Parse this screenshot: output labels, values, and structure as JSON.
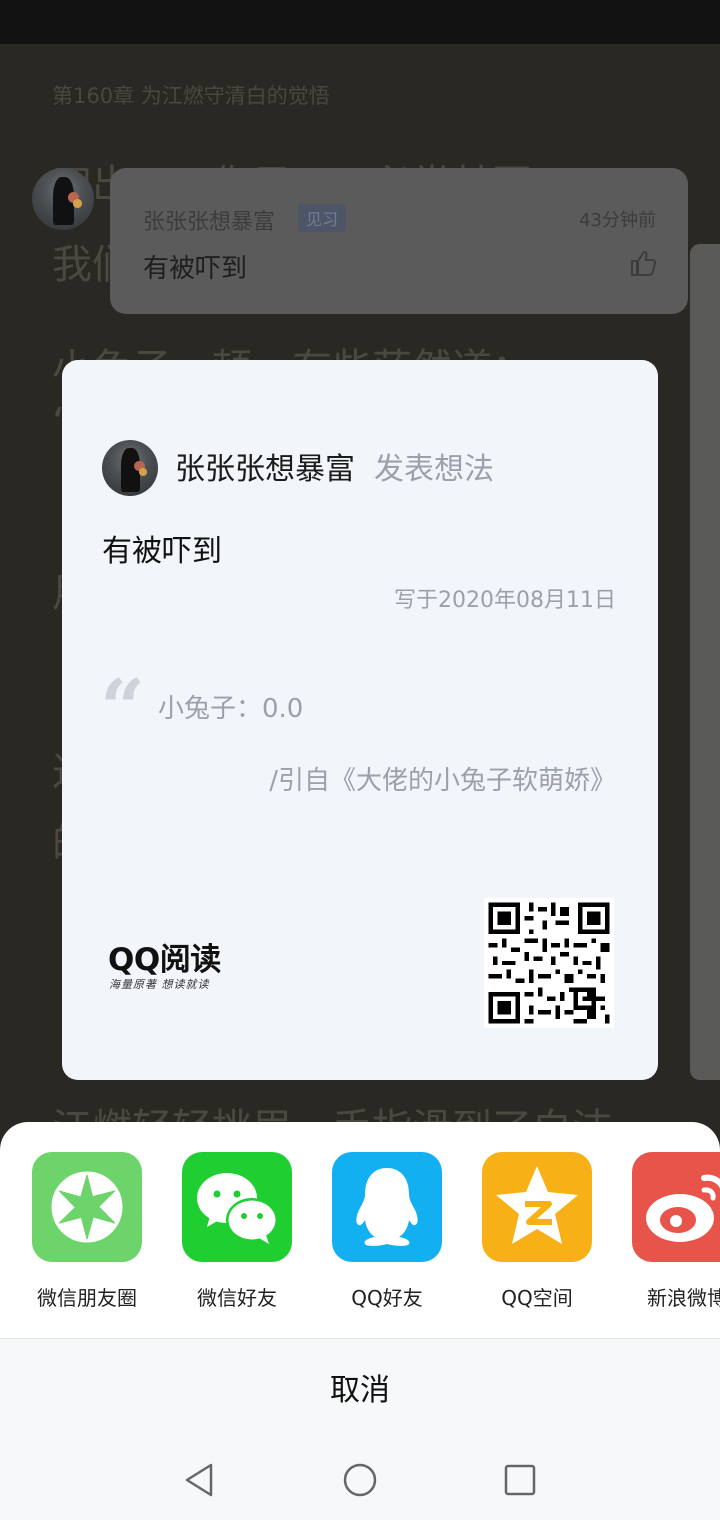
{
  "background": {
    "chapter_title": "第160章 为江燃守清白的觉悟",
    "lines": [
      "四出一、你子一、必党甘写",
      "我们",
      "小兔子一顿，有些茫然道：",
      "“",
      "",
      "用",
      "",
      "过",
      "的",
      "江燃轻轻挑眉，手指滑到了白洁"
    ],
    "comment": {
      "username": "张张张想暴富",
      "badge": "见习",
      "time": "43分钟前",
      "text": "有被吓到",
      "like_icon": "thumbs-up-icon"
    }
  },
  "card": {
    "author": "张张张想暴富",
    "action": "发表想法",
    "content": "有被吓到",
    "date": "写于2020年08月11日",
    "quote_mark": "“",
    "quote": "小兔子：0.0",
    "source": "/引自《大佬的小兔子软萌娇》",
    "brand": "QQ阅读",
    "slogan": "海量原著 想读就读"
  },
  "share": {
    "items": [
      {
        "label": "微信朋友圈",
        "icon": "moments-icon",
        "color": "#6cd46a"
      },
      {
        "label": "微信好友",
        "icon": "wechat-icon",
        "color": "#1fce31"
      },
      {
        "label": "QQ好友",
        "icon": "qq-icon",
        "color": "#12b0f0"
      },
      {
        "label": "QQ空间",
        "icon": "qzone-icon",
        "color": "#f7b117"
      },
      {
        "label": "新浪微博",
        "icon": "weibo-icon",
        "color": "#e8534a"
      }
    ],
    "cancel": "取消"
  },
  "nav": {
    "back_icon": "back-triangle-icon",
    "home_icon": "home-circle-icon",
    "recents_icon": "recents-square-icon"
  }
}
